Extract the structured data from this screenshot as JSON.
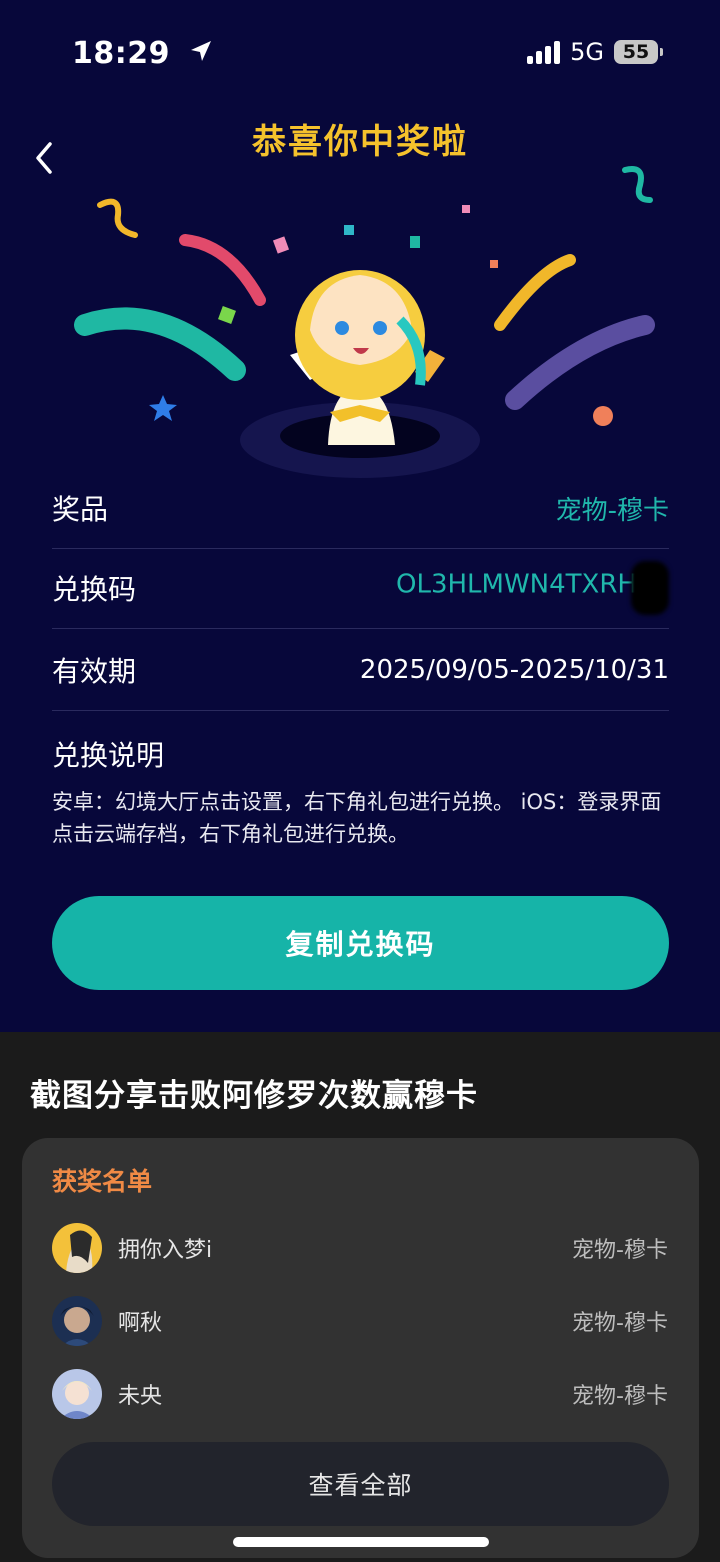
{
  "status": {
    "time": "18:29",
    "network": "5G",
    "battery": "55"
  },
  "header": {
    "title": "恭喜你中奖啦"
  },
  "prize": {
    "prize_label": "奖品",
    "prize_value": "宠物-穆卡",
    "code_label": "兑换码",
    "code_value": "OL3HLMWN4TXRH",
    "validity_label": "有效期",
    "validity_value": "2025/09/05-2025/10/31",
    "instructions_label": "兑换说明",
    "instructions_text": "安卓：幻境大厅点击设置，右下角礼包进行兑换。 iOS：登录界面点击云端存档，右下角礼包进行兑换。"
  },
  "copy_button_label": "复制兑换码",
  "share": {
    "title": "截图分享击败阿修罗次数赢穆卡",
    "list_title": "获奖名单",
    "winners": [
      {
        "name": "拥你入梦i",
        "prize": "宠物-穆卡"
      },
      {
        "name": "啊秋",
        "prize": "宠物-穆卡"
      },
      {
        "name": "未央",
        "prize": "宠物-穆卡"
      }
    ],
    "view_all_label": "查看全部"
  },
  "colors": {
    "accent": "#16b4a8",
    "title": "#f5c22c",
    "list_title": "#f08a45",
    "background": "#07073a"
  }
}
